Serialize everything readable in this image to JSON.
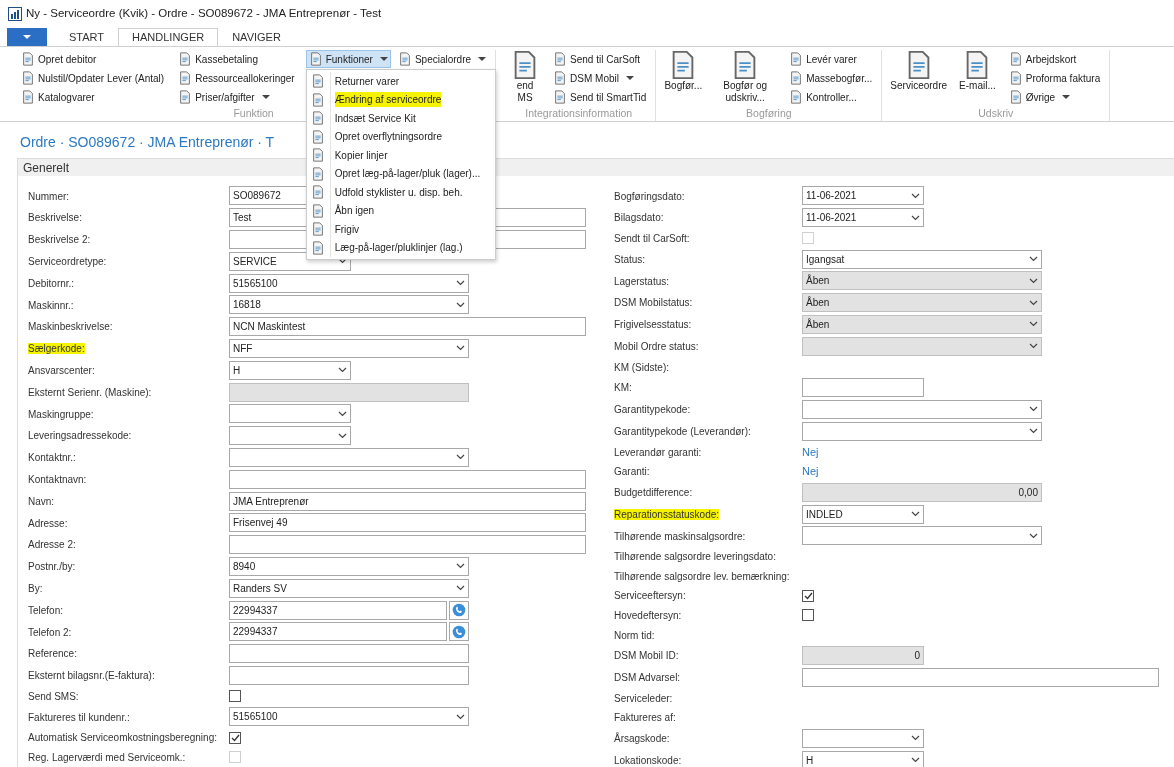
{
  "window": {
    "title": "Ny - Serviceordre (Kvik) - Ordre - SO089672 - JMA Entreprenør - Test"
  },
  "ribbon_tabs": [
    {
      "label": "START",
      "selected": false
    },
    {
      "label": "HANDLINGER",
      "selected": true
    },
    {
      "label": "NAVIGER",
      "selected": false
    }
  ],
  "ribbon_groups": [
    {
      "label": "Funktion",
      "columns": [
        [
          {
            "label": "Opret debitor",
            "dropdown": false,
            "pressed": false
          },
          {
            "label": "Nulstil/Opdater Lever (Antal)",
            "dropdown": false,
            "pressed": false
          },
          {
            "label": "Katalogvarer",
            "dropdown": false,
            "pressed": false
          }
        ],
        [
          {
            "label": "Kassebetaling",
            "dropdown": false,
            "pressed": false
          },
          {
            "label": "Ressourceallokeringer",
            "dropdown": false,
            "pressed": false
          },
          {
            "label": "Priser/afgifter",
            "dropdown": true,
            "pressed": false
          }
        ],
        [
          {
            "label": "Funktioner",
            "dropdown": true,
            "pressed": true
          },
          {
            "label": "Specialordre",
            "dropdown": true,
            "pressed": false
          }
        ]
      ]
    },
    {
      "label": "Integrationsinformation",
      "large_buttons": [
        {
          "label": "end MS"
        }
      ],
      "columns": [
        [
          {
            "label": "Send til CarSoft",
            "dropdown": false,
            "pressed": false
          },
          {
            "label": "DSM Mobil",
            "dropdown": true,
            "pressed": false
          },
          {
            "label": "Send til SmartTid",
            "dropdown": false,
            "pressed": false
          }
        ]
      ]
    },
    {
      "label": "Bogføring",
      "large_buttons": [
        {
          "label": "Bogfør..."
        },
        {
          "label": "Bogfør og udskriv..."
        }
      ],
      "columns": [
        [
          {
            "label": "Levér varer",
            "dropdown": false,
            "pressed": false
          },
          {
            "label": "Massebogfør...",
            "dropdown": false,
            "pressed": false
          },
          {
            "label": "Kontroller...",
            "dropdown": false,
            "pressed": false
          }
        ]
      ]
    },
    {
      "label": "Udskriv",
      "large_buttons": [
        {
          "label": "Serviceordre"
        },
        {
          "label": "E-mail..."
        }
      ],
      "columns": [
        [
          {
            "label": "Arbejdskort",
            "dropdown": false,
            "pressed": false
          },
          {
            "label": "Proforma faktura",
            "dropdown": false,
            "pressed": false
          },
          {
            "label": "Øvrige",
            "dropdown": true,
            "pressed": false
          }
        ]
      ]
    }
  ],
  "dropdown_menu": {
    "items": [
      {
        "label": "Returner varer",
        "highlighted": false
      },
      {
        "label": "Ændring af serviceordre",
        "highlighted": true
      },
      {
        "label": "Indsæt Service Kit",
        "highlighted": false
      },
      {
        "label": "Opret overflytningsordre",
        "highlighted": false
      },
      {
        "label": "Kopier linjer",
        "highlighted": false
      },
      {
        "label": "Opret læg-på-lager/pluk (lager)...",
        "highlighted": false
      },
      {
        "label": "Udfold styklister u. disp. beh.",
        "highlighted": false
      },
      {
        "label": "Åbn igen",
        "highlighted": false
      },
      {
        "label": "Frigiv",
        "highlighted": false
      },
      {
        "label": "Læg-på-lager/pluklinjer (lag.)",
        "highlighted": false
      }
    ]
  },
  "page_title": "Ordre · SO089672 · JMA Entreprenør · T",
  "section": {
    "title": "Generelt",
    "left_fields": [
      {
        "label": "Nummer:",
        "kind": "text",
        "value": "SO089672",
        "disabled": false,
        "highlighted": false
      },
      {
        "label": "Beskrivelse:",
        "kind": "text",
        "value": "Test",
        "disabled": false,
        "highlighted": false
      },
      {
        "label": "Beskrivelse 2:",
        "kind": "text",
        "disabled": false,
        "highlighted": false
      },
      {
        "label": "Serviceordretype:",
        "kind": "select",
        "value": "SERVICE",
        "disabled": false,
        "highlighted": false
      },
      {
        "label": "Debitornr.:",
        "kind": "select",
        "value": "51565100",
        "disabled": false,
        "highlighted": false
      },
      {
        "label": "Maskinnr.:",
        "kind": "select",
        "value": "16818",
        "disabled": false,
        "highlighted": false
      },
      {
        "label": "Maskinbeskrivelse:",
        "kind": "text",
        "value": "NCN Maskintest",
        "disabled": false,
        "highlighted": false
      },
      {
        "label": "Sælgerkode:",
        "kind": "select",
        "value": "NFF",
        "disabled": false,
        "highlighted": true
      },
      {
        "label": "Ansvarscenter:",
        "kind": "select",
        "value": "H",
        "disabled": false,
        "highlighted": false
      },
      {
        "label": "Eksternt Serienr. (Maskine):",
        "kind": "text",
        "disabled": true,
        "highlighted": false
      },
      {
        "label": "Maskingruppe:",
        "kind": "select",
        "disabled": false,
        "highlighted": false
      },
      {
        "label": "Leveringsadressekode:",
        "kind": "select",
        "disabled": false,
        "highlighted": false
      },
      {
        "label": "Kontaktnr.:",
        "kind": "select",
        "disabled": false,
        "highlighted": false
      },
      {
        "label": "Kontaktnavn:",
        "kind": "text",
        "disabled": false,
        "highlighted": false
      },
      {
        "label": "Navn:",
        "kind": "text",
        "value": "JMA Entreprenør",
        "disabled": false,
        "highlighted": false
      },
      {
        "label": "Adresse:",
        "kind": "text",
        "value": "Frisenvej 49",
        "disabled": false,
        "highlighted": false
      },
      {
        "label": "Adresse 2:",
        "kind": "text",
        "disabled": false,
        "highlighted": false
      },
      {
        "label": "Postnr./by:",
        "kind": "select",
        "value": "8940",
        "disabled": false,
        "highlighted": false
      },
      {
        "label": "By:",
        "kind": "select",
        "value": "Randers SV",
        "disabled": false,
        "highlighted": false
      },
      {
        "label": "Telefon:",
        "kind": "phone",
        "value": "22994337",
        "disabled": false,
        "highlighted": false
      },
      {
        "label": "Telefon 2:",
        "kind": "phone",
        "value": "22994337",
        "disabled": false,
        "highlighted": false
      },
      {
        "label": "Reference:",
        "kind": "text",
        "disabled": false,
        "highlighted": false
      },
      {
        "label": "Eksternt bilagsnr.(E-faktura):",
        "kind": "text",
        "disabled": false,
        "highlighted": false
      },
      {
        "label": "Send SMS:",
        "kind": "check",
        "checked": false,
        "disabled": false,
        "highlighted": false
      },
      {
        "label": "Faktureres til kundenr.:",
        "kind": "select",
        "value": "51565100",
        "disabled": false,
        "highlighted": false
      },
      {
        "label": "Automatisk Serviceomkostningsberegning:",
        "kind": "check",
        "checked": true,
        "disabled": false,
        "highlighted": false
      },
      {
        "label": "Reg. Lagerværdi med Serviceomk.:",
        "kind": "check",
        "checked": false,
        "disabled": true,
        "highlighted": false
      }
    ],
    "right_fields": [
      {
        "label": "Bogføringsdato:",
        "kind": "select",
        "value": "11-06-2021",
        "disabled": false,
        "highlighted": false
      },
      {
        "label": "Bilagsdato:",
        "kind": "select",
        "value": "11-06-2021",
        "disabled": false,
        "highlighted": false
      },
      {
        "label": "Sendt til CarSoft:",
        "kind": "check",
        "checked": false,
        "disabled": true,
        "highlighted": false
      },
      {
        "label": "Status:",
        "kind": "select",
        "value": "Igangsat",
        "disabled": false,
        "highlighted": false
      },
      {
        "label": "Lagerstatus:",
        "kind": "select",
        "value": "Åben",
        "disabled": true,
        "highlighted": false
      },
      {
        "label": "DSM Mobilstatus:",
        "kind": "select",
        "value": "Åben",
        "disabled": true,
        "highlighted": false
      },
      {
        "label": "Frigivelsesstatus:",
        "kind": "select",
        "value": "Åben",
        "disabled": true,
        "highlighted": false
      },
      {
        "label": "Mobil Ordre status:",
        "kind": "select",
        "disabled": true,
        "highlighted": false
      },
      {
        "label": "KM (Sidste):",
        "kind": "none",
        "highlighted": false
      },
      {
        "label": "KM:",
        "kind": "text",
        "disabled": false,
        "highlighted": false
      },
      {
        "label": "Garantitypekode:",
        "kind": "select",
        "disabled": false,
        "highlighted": false
      },
      {
        "label": "Garantitypekode (Leverandør):",
        "kind": "select",
        "disabled": false,
        "highlighted": false
      },
      {
        "label": "Leverandør garanti:",
        "kind": "link",
        "value": "Nej",
        "highlighted": false
      },
      {
        "label": "Garanti:",
        "kind": "link",
        "value": "Nej",
        "highlighted": false
      },
      {
        "label": "Budgetdifference:",
        "kind": "text",
        "value": "0,00",
        "disabled": true,
        "highlighted": false
      },
      {
        "label": "Reparationsstatuskode:",
        "kind": "select",
        "value": "INDLED",
        "disabled": false,
        "highlighted": true
      },
      {
        "label": "Tilhørende maskinsalgsordre:",
        "kind": "select",
        "disabled": false,
        "highlighted": false
      },
      {
        "label": "Tilhørende salgsordre leveringsdato:",
        "kind": "none",
        "highlighted": false
      },
      {
        "label": "Tilhørende salgsordre lev. bemærkning:",
        "kind": "none",
        "highlighted": false
      },
      {
        "label": "Serviceeftersyn:",
        "kind": "check",
        "checked": true,
        "disabled": false,
        "highlighted": false
      },
      {
        "label": "Hovedeftersyn:",
        "kind": "check",
        "checked": false,
        "disabled": false,
        "highlighted": false
      },
      {
        "label": "Norm tid:",
        "kind": "none",
        "highlighted": false
      },
      {
        "label": "DSM Mobil ID:",
        "kind": "text",
        "value": "0",
        "disabled": true,
        "highlighted": false
      },
      {
        "label": "DSM Advarsel:",
        "kind": "text",
        "disabled": false,
        "highlighted": false
      },
      {
        "label": "Serviceleder:",
        "kind": "none",
        "highlighted": false
      },
      {
        "label": "Faktureres af:",
        "kind": "none",
        "highlighted": false
      },
      {
        "label": "Årsagskode:",
        "kind": "select",
        "disabled": false,
        "highlighted": false
      },
      {
        "label": "Lokationskode:",
        "kind": "select",
        "value": "H",
        "disabled": false,
        "highlighted": false
      }
    ]
  }
}
